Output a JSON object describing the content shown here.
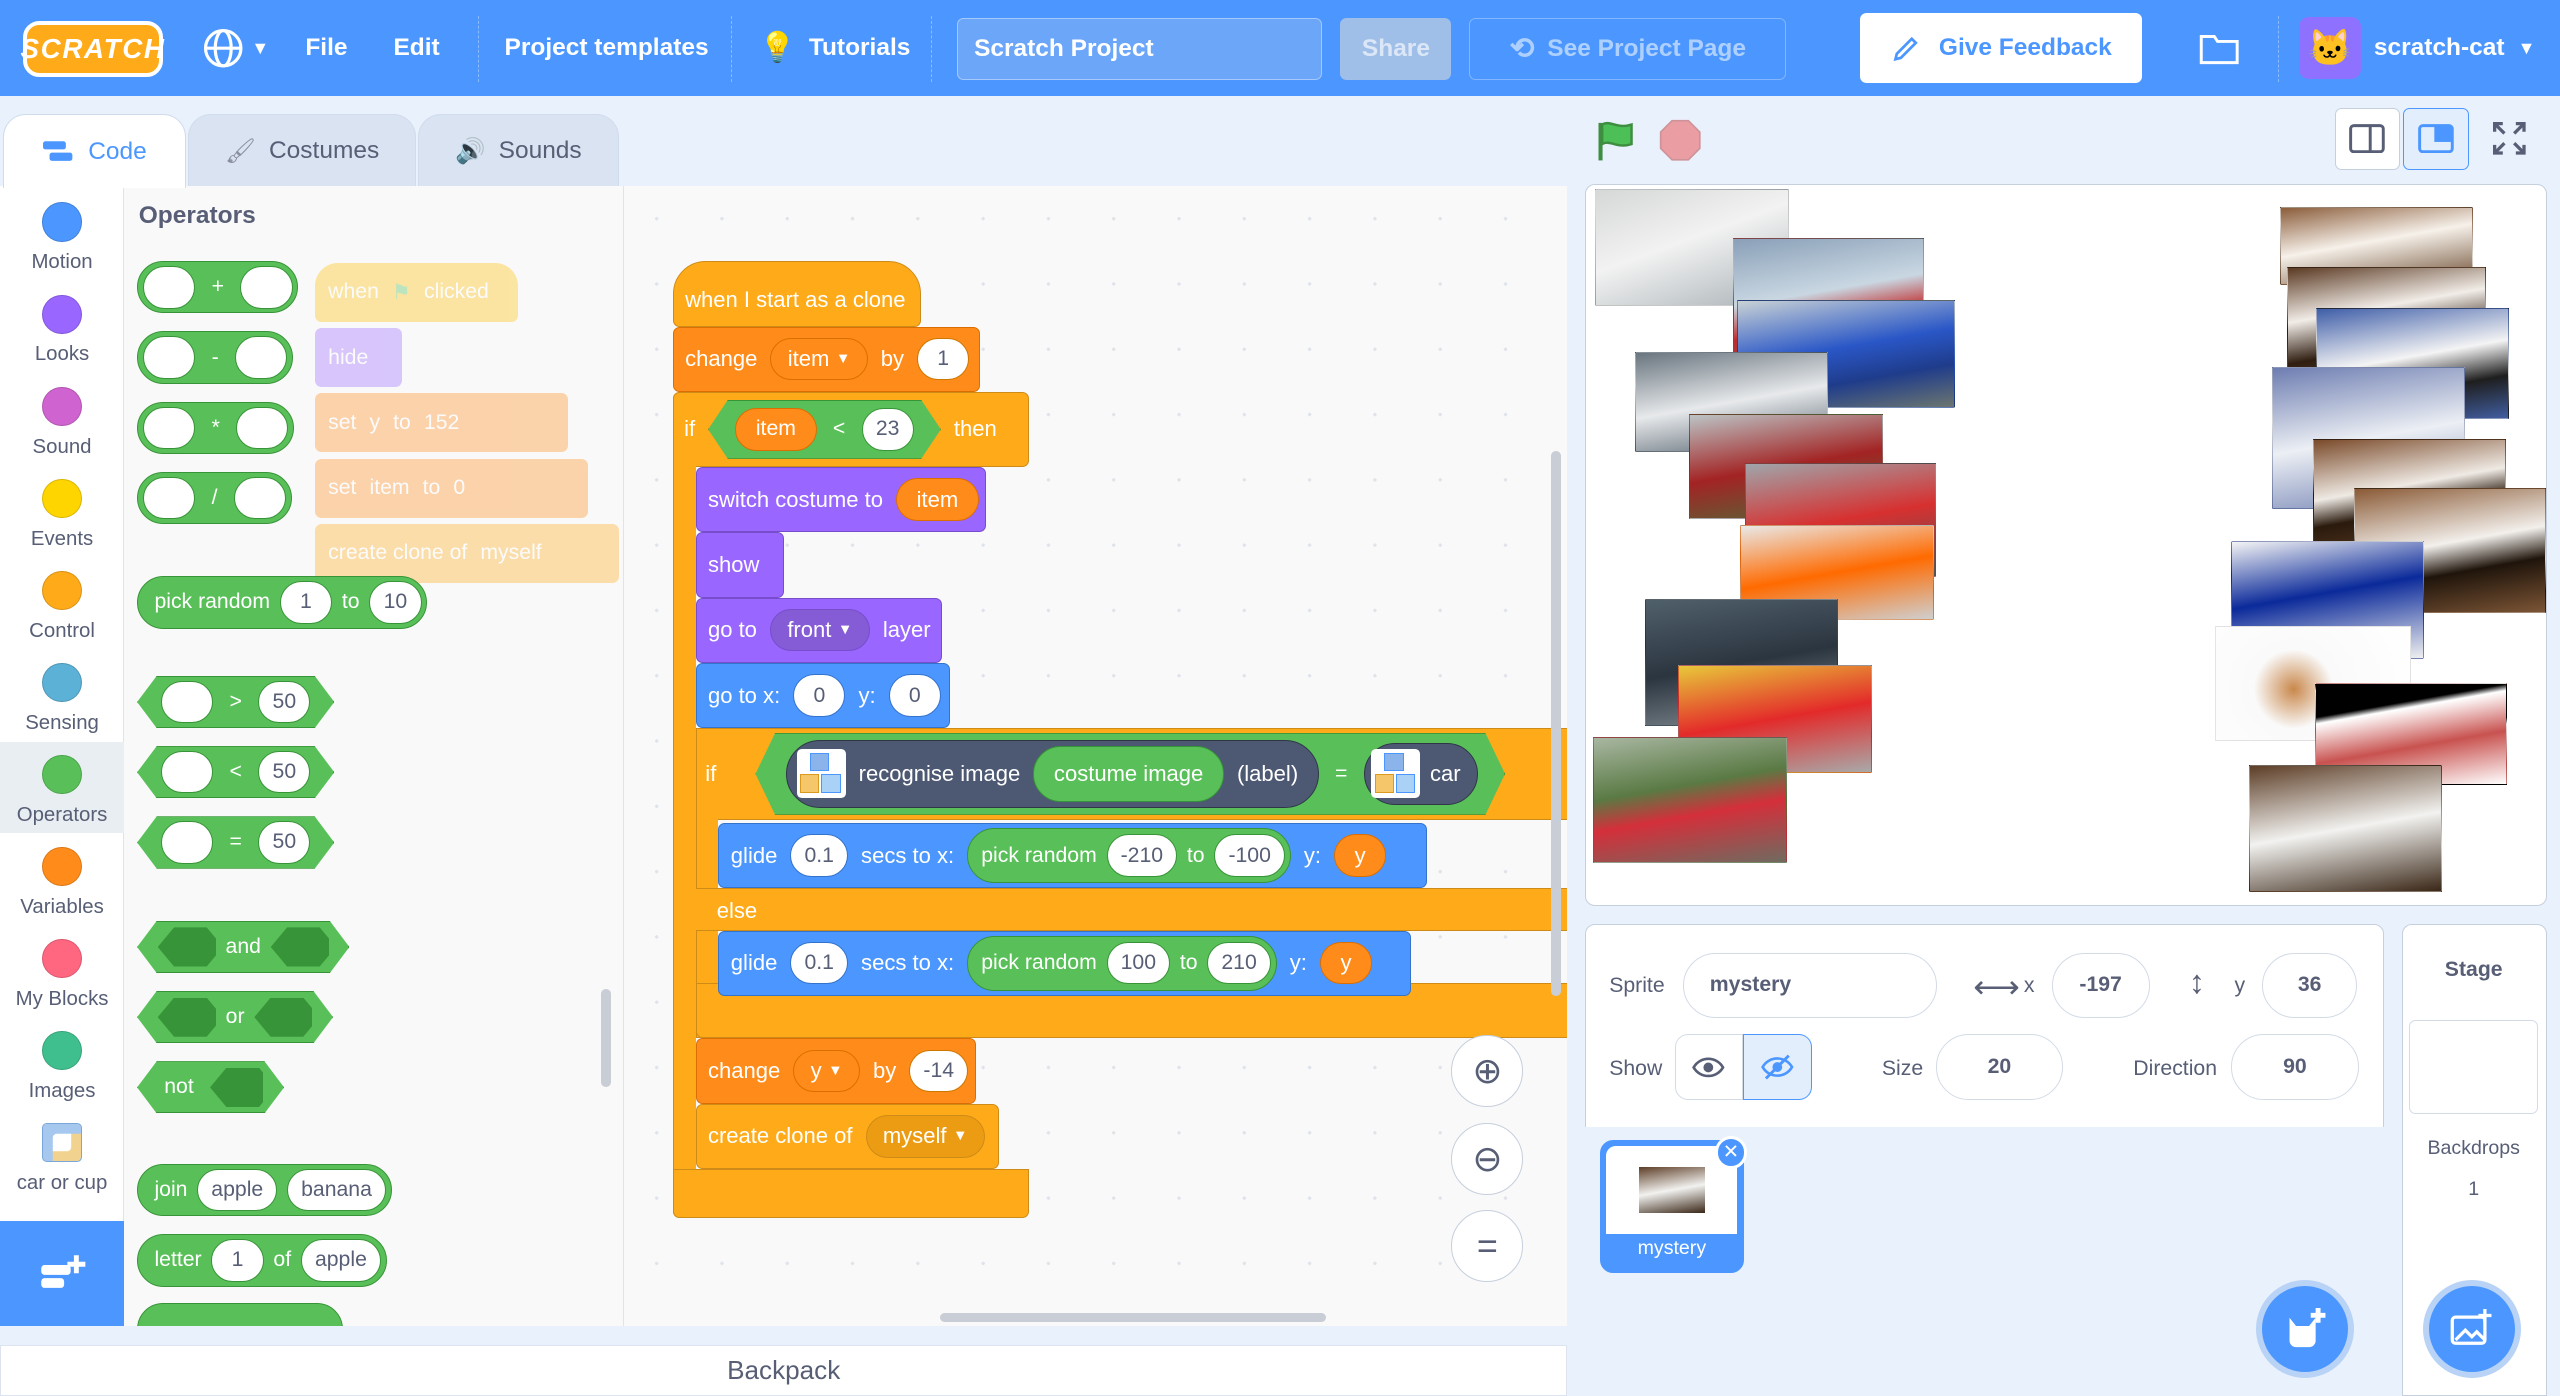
{
  "menubar": {
    "logo": "SCRATCH",
    "file": "File",
    "edit": "Edit",
    "templates": "Project templates",
    "tutorials": "Tutorials",
    "project_title": "Scratch Project",
    "share": "Share",
    "see_page": "See Project Page",
    "feedback": "Give Feedback",
    "username": "scratch-cat"
  },
  "tabs": [
    "Code",
    "Costumes",
    "Sounds"
  ],
  "categories": [
    {
      "label": "Motion",
      "color": "#4c97ff"
    },
    {
      "label": "Looks",
      "color": "#9966ff"
    },
    {
      "label": "Sound",
      "color": "#cf63cf"
    },
    {
      "label": "Events",
      "color": "#ffd500"
    },
    {
      "label": "Control",
      "color": "#ffab19"
    },
    {
      "label": "Sensing",
      "color": "#5cb1d6"
    },
    {
      "label": "Operators",
      "color": "#59c059"
    },
    {
      "label": "Variables",
      "color": "#ff8c1a"
    },
    {
      "label": "My Blocks",
      "color": "#ff6680"
    },
    {
      "label": "Images",
      "color": "#40bf8e"
    },
    {
      "label": "car or cup",
      "color": "#ffffff"
    }
  ],
  "palette": {
    "title": "Operators",
    "math_ops": [
      "+",
      "-",
      "*",
      "/"
    ],
    "pick_random": {
      "label": "pick random",
      "from": "1",
      "to_label": "to",
      "to": "10"
    },
    "compare": [
      {
        "op": ">",
        "value": "50"
      },
      {
        "op": "<",
        "value": "50"
      },
      {
        "op": "=",
        "value": "50"
      }
    ],
    "and": "and",
    "or": "or",
    "not": "not",
    "join": {
      "label": "join",
      "a": "apple",
      "b": "banana"
    },
    "letter": {
      "label": "letter",
      "n": "1",
      "of": "of",
      "word": "apple"
    },
    "ghost": {
      "when_clicked_a": "when",
      "when_clicked_b": "clicked",
      "hide": "hide",
      "set1": "set",
      "set1_var": "y",
      "set1_to": "to",
      "set1_val": "152",
      "set2": "set",
      "set2_var": "item",
      "set2_to": "to",
      "set2_val": "0",
      "clone": "create clone of",
      "clone_target": "myself"
    }
  },
  "script": {
    "hat": "when I start as a clone",
    "change_item": {
      "label": "change",
      "var": "item",
      "by": "by",
      "val": "1"
    },
    "if1": {
      "label": "if",
      "var": "item",
      "op": "<",
      "val": "23",
      "then": "then"
    },
    "switch_costume": {
      "label": "switch costume to",
      "val": "item"
    },
    "show": "show",
    "goto_layer": {
      "label": "go to",
      "val": "front",
      "suffix": "layer"
    },
    "goto_xy": {
      "label": "go to x:",
      "x": "0",
      "y_label": "y:",
      "y": "0"
    },
    "if2": {
      "label": "if",
      "recognise": "recognise image",
      "costume": "costume image",
      "label_val": "(label)",
      "eq": "=",
      "class": "car"
    },
    "glide1": {
      "label": "glide",
      "secs": "0.1",
      "secs_label": "secs to x:",
      "pick": "pick random",
      "from": "-210",
      "to": "to",
      "to_val": "-100",
      "y_label": "y:",
      "y": "y"
    },
    "else": "else",
    "glide2": {
      "label": "glide",
      "secs": "0.1",
      "secs_label": "secs to x:",
      "pick": "pick random",
      "from": "100",
      "to": "to",
      "to_val": "210",
      "y_label": "y:",
      "y": "y"
    },
    "change_y": {
      "label": "change",
      "var": "y",
      "by": "by",
      "val": "-14"
    },
    "create_clone": {
      "label": "create clone of",
      "val": "myself"
    }
  },
  "backpack": "Backpack",
  "sprite_info": {
    "sprite_label": "Sprite",
    "sprite_name": "mystery",
    "x_label": "x",
    "x": "-197",
    "y_label": "y",
    "y": "36",
    "show_label": "Show",
    "size_label": "Size",
    "size": "20",
    "direction_label": "Direction",
    "direction": "90"
  },
  "sprites": [
    {
      "name": "mystery"
    }
  ],
  "stage_pane": {
    "title": "Stage",
    "backdrops_label": "Backdrops",
    "backdrops": "1"
  },
  "colors": {
    "brand": "#4c97ff",
    "operators": "#59c059",
    "control": "#ffab19",
    "variables": "#ff8c1a",
    "looks": "#9966ff",
    "motion": "#4c97ff"
  }
}
